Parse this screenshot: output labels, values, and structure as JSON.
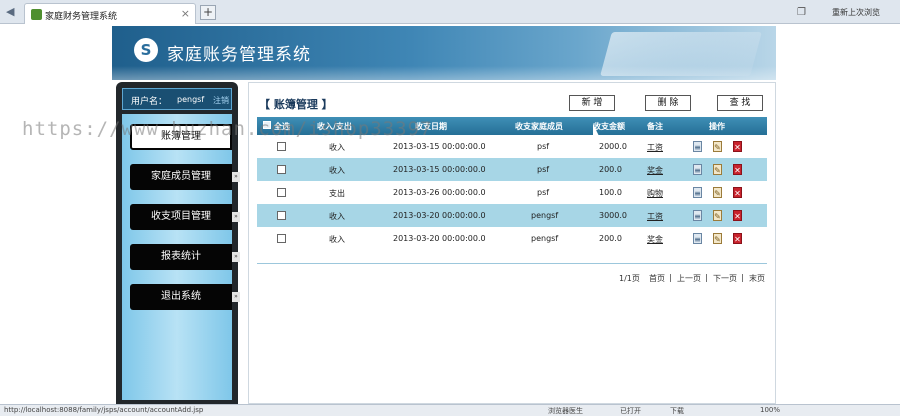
{
  "browser": {
    "tab_title": "家庭财务管理系统",
    "tab_close": "×",
    "new_tab": "+",
    "restore_label": "重新上次浏览",
    "status_url": "http://localhost:8088/family/jsps/account/accountAdd.jsp",
    "status_items": [
      "浏览器医生",
      "已打开",
      "下载",
      "100%"
    ]
  },
  "banner": {
    "title": "家庭账务管理系统",
    "logo_glyph": "S"
  },
  "sidebar": {
    "user_label": "用户名：",
    "username": "pengsf",
    "logout": "注销",
    "items": [
      {
        "label": "账簿管理",
        "active": true
      },
      {
        "label": "家庭成员管理",
        "active": false
      },
      {
        "label": "收支项目管理",
        "active": false
      },
      {
        "label": "报表统计",
        "active": false
      },
      {
        "label": "退出系统",
        "active": false
      }
    ]
  },
  "main": {
    "title": "【 账簿管理 】",
    "buttons": {
      "add": "新 增",
      "delete": "删 除",
      "search": "查 找"
    },
    "columns": {
      "select_all": "全选",
      "type": "收入/支出",
      "date": "收支日期",
      "member": "收支家庭成员",
      "amount": "收支金额",
      "note": "备注",
      "ops": "操作"
    },
    "rows": [
      {
        "type": "收入",
        "date": "2013-03-15 00:00:00.0",
        "member": "psf",
        "amount": "2000.0",
        "note": "工资"
      },
      {
        "type": "收入",
        "date": "2013-03-15 00:00:00.0",
        "member": "psf",
        "amount": "200.0",
        "note": "奖金"
      },
      {
        "type": "支出",
        "date": "2013-03-26 00:00:00.0",
        "member": "psf",
        "amount": "100.0",
        "note": "购物"
      },
      {
        "type": "收入",
        "date": "2013-03-20 00:00:00.0",
        "member": "pengsf",
        "amount": "3000.0",
        "note": "工资"
      },
      {
        "type": "收入",
        "date": "2013-03-20 00:00:00.0",
        "member": "pengsf",
        "amount": "200.0",
        "note": "奖金"
      }
    ],
    "pager": {
      "pages": "1/1页",
      "first": "首页",
      "prev": "上一页",
      "next": "下一页",
      "last": "末页",
      "sep": "|"
    }
  },
  "watermark": "https://www.huzhan.com/ishop33397",
  "icons": {
    "view": "view-icon",
    "edit": "edit-icon",
    "delete": "delete-icon"
  },
  "colors": {
    "header_blue": "#256f96",
    "row_alt": "#a7d6e6",
    "sidebar_dark": "#22272b",
    "menu_light": "#b8e2f5"
  }
}
